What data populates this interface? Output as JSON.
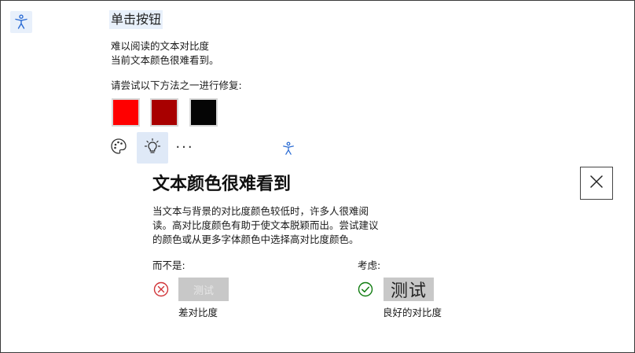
{
  "app": {
    "header_button_label": "单击按钮"
  },
  "issue": {
    "heading": "难以阅读的文本对比度",
    "description": "当前文本颜色很难看到。",
    "fix_prompt": "请尝试以下方法之一进行修复:",
    "swatches": [
      {
        "name": "red",
        "color": "#ff0000"
      },
      {
        "name": "dark-red",
        "color": "#a80000"
      },
      {
        "name": "black",
        "color": "#050505"
      }
    ],
    "more_label": "···"
  },
  "card": {
    "title": "文本颜色很难看到",
    "body_line1": "当文本与背景的对比度颜色较低时，许多人很难阅",
    "body_line2": "读。高对比度颜色有助于使文本脱颖而出。尝试建议",
    "body_line3": "的颜色或从更多字体颜色中选择高对比度颜色。",
    "instead_label": "而不是:",
    "consider_label": "考虑:",
    "bad_sample_text": "测试",
    "good_sample_text": "测试",
    "bad_caption": "差对比度",
    "good_caption": "良好的对比度"
  },
  "colors": {
    "accent": "#2b6cd4",
    "error": "#d13438",
    "success": "#107c10"
  },
  "icons": {
    "accessibility": "accessibility-icon",
    "palette": "palette-icon",
    "lightbulb": "lightbulb-icon",
    "close": "close-icon",
    "error": "error-circle-icon",
    "success": "checkmark-circle-icon"
  }
}
